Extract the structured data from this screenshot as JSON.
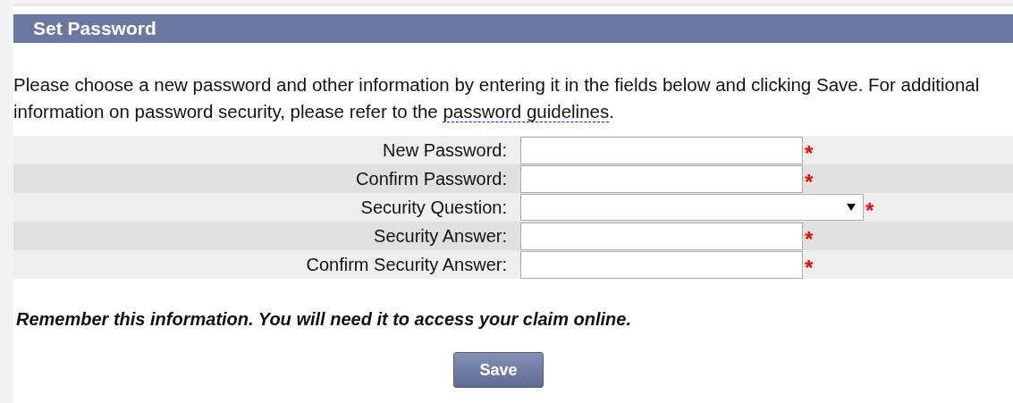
{
  "header": {
    "title": "Set Password"
  },
  "intro": {
    "text": "Please choose a new password and other information by entering it in the fields below and clicking Save. For additional information on password security, please refer to the ",
    "link": "password guidelines",
    "after": "."
  },
  "fields": [
    {
      "label": "New Password:",
      "kind": "password",
      "required_mark": "*"
    },
    {
      "label": "Confirm Password:",
      "kind": "password",
      "required_mark": "*"
    },
    {
      "label": "Security Question:",
      "kind": "select",
      "required_mark": "*"
    },
    {
      "label": "Security Answer:",
      "kind": "text",
      "required_mark": "*"
    },
    {
      "label": "Confirm Security Answer:",
      "kind": "text",
      "required_mark": "*"
    }
  ],
  "reminder": "Remember this information. You will need it to access your claim online.",
  "buttons": [
    {
      "label": "Save"
    }
  ]
}
